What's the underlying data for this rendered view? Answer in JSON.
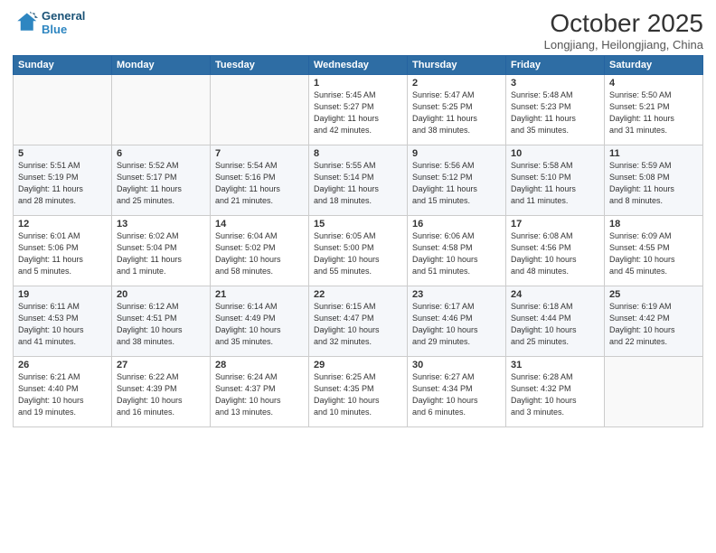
{
  "header": {
    "logo_line1": "General",
    "logo_line2": "Blue",
    "month_year": "October 2025",
    "location": "Longjiang, Heilongjiang, China"
  },
  "weekdays": [
    "Sunday",
    "Monday",
    "Tuesday",
    "Wednesday",
    "Thursday",
    "Friday",
    "Saturday"
  ],
  "weeks": [
    [
      {
        "day": "",
        "info": ""
      },
      {
        "day": "",
        "info": ""
      },
      {
        "day": "",
        "info": ""
      },
      {
        "day": "1",
        "info": "Sunrise: 5:45 AM\nSunset: 5:27 PM\nDaylight: 11 hours\nand 42 minutes."
      },
      {
        "day": "2",
        "info": "Sunrise: 5:47 AM\nSunset: 5:25 PM\nDaylight: 11 hours\nand 38 minutes."
      },
      {
        "day": "3",
        "info": "Sunrise: 5:48 AM\nSunset: 5:23 PM\nDaylight: 11 hours\nand 35 minutes."
      },
      {
        "day": "4",
        "info": "Sunrise: 5:50 AM\nSunset: 5:21 PM\nDaylight: 11 hours\nand 31 minutes."
      }
    ],
    [
      {
        "day": "5",
        "info": "Sunrise: 5:51 AM\nSunset: 5:19 PM\nDaylight: 11 hours\nand 28 minutes."
      },
      {
        "day": "6",
        "info": "Sunrise: 5:52 AM\nSunset: 5:17 PM\nDaylight: 11 hours\nand 25 minutes."
      },
      {
        "day": "7",
        "info": "Sunrise: 5:54 AM\nSunset: 5:16 PM\nDaylight: 11 hours\nand 21 minutes."
      },
      {
        "day": "8",
        "info": "Sunrise: 5:55 AM\nSunset: 5:14 PM\nDaylight: 11 hours\nand 18 minutes."
      },
      {
        "day": "9",
        "info": "Sunrise: 5:56 AM\nSunset: 5:12 PM\nDaylight: 11 hours\nand 15 minutes."
      },
      {
        "day": "10",
        "info": "Sunrise: 5:58 AM\nSunset: 5:10 PM\nDaylight: 11 hours\nand 11 minutes."
      },
      {
        "day": "11",
        "info": "Sunrise: 5:59 AM\nSunset: 5:08 PM\nDaylight: 11 hours\nand 8 minutes."
      }
    ],
    [
      {
        "day": "12",
        "info": "Sunrise: 6:01 AM\nSunset: 5:06 PM\nDaylight: 11 hours\nand 5 minutes."
      },
      {
        "day": "13",
        "info": "Sunrise: 6:02 AM\nSunset: 5:04 PM\nDaylight: 11 hours\nand 1 minute."
      },
      {
        "day": "14",
        "info": "Sunrise: 6:04 AM\nSunset: 5:02 PM\nDaylight: 10 hours\nand 58 minutes."
      },
      {
        "day": "15",
        "info": "Sunrise: 6:05 AM\nSunset: 5:00 PM\nDaylight: 10 hours\nand 55 minutes."
      },
      {
        "day": "16",
        "info": "Sunrise: 6:06 AM\nSunset: 4:58 PM\nDaylight: 10 hours\nand 51 minutes."
      },
      {
        "day": "17",
        "info": "Sunrise: 6:08 AM\nSunset: 4:56 PM\nDaylight: 10 hours\nand 48 minutes."
      },
      {
        "day": "18",
        "info": "Sunrise: 6:09 AM\nSunset: 4:55 PM\nDaylight: 10 hours\nand 45 minutes."
      }
    ],
    [
      {
        "day": "19",
        "info": "Sunrise: 6:11 AM\nSunset: 4:53 PM\nDaylight: 10 hours\nand 41 minutes."
      },
      {
        "day": "20",
        "info": "Sunrise: 6:12 AM\nSunset: 4:51 PM\nDaylight: 10 hours\nand 38 minutes."
      },
      {
        "day": "21",
        "info": "Sunrise: 6:14 AM\nSunset: 4:49 PM\nDaylight: 10 hours\nand 35 minutes."
      },
      {
        "day": "22",
        "info": "Sunrise: 6:15 AM\nSunset: 4:47 PM\nDaylight: 10 hours\nand 32 minutes."
      },
      {
        "day": "23",
        "info": "Sunrise: 6:17 AM\nSunset: 4:46 PM\nDaylight: 10 hours\nand 29 minutes."
      },
      {
        "day": "24",
        "info": "Sunrise: 6:18 AM\nSunset: 4:44 PM\nDaylight: 10 hours\nand 25 minutes."
      },
      {
        "day": "25",
        "info": "Sunrise: 6:19 AM\nSunset: 4:42 PM\nDaylight: 10 hours\nand 22 minutes."
      }
    ],
    [
      {
        "day": "26",
        "info": "Sunrise: 6:21 AM\nSunset: 4:40 PM\nDaylight: 10 hours\nand 19 minutes."
      },
      {
        "day": "27",
        "info": "Sunrise: 6:22 AM\nSunset: 4:39 PM\nDaylight: 10 hours\nand 16 minutes."
      },
      {
        "day": "28",
        "info": "Sunrise: 6:24 AM\nSunset: 4:37 PM\nDaylight: 10 hours\nand 13 minutes."
      },
      {
        "day": "29",
        "info": "Sunrise: 6:25 AM\nSunset: 4:35 PM\nDaylight: 10 hours\nand 10 minutes."
      },
      {
        "day": "30",
        "info": "Sunrise: 6:27 AM\nSunset: 4:34 PM\nDaylight: 10 hours\nand 6 minutes."
      },
      {
        "day": "31",
        "info": "Sunrise: 6:28 AM\nSunset: 4:32 PM\nDaylight: 10 hours\nand 3 minutes."
      },
      {
        "day": "",
        "info": ""
      }
    ]
  ]
}
